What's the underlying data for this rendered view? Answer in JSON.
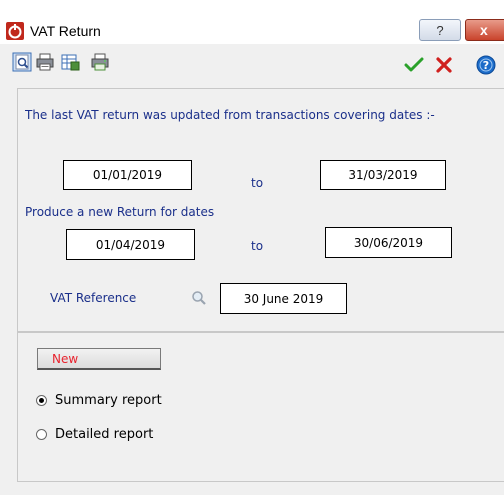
{
  "window": {
    "title": "VAT Return",
    "help_label": "?",
    "close_label": "x"
  },
  "toolbar": {
    "tools": [
      "preview-icon",
      "print-icon",
      "export-icon",
      "print-setup-icon"
    ],
    "actions": [
      "confirm-check-icon",
      "cancel-x-icon",
      "help-info-icon"
    ]
  },
  "last_return": {
    "caption": "The last VAT return was updated from transactions covering dates :-",
    "from_date": "01/01/2019",
    "to_label": "to",
    "to_date": "31/03/2019"
  },
  "new_return": {
    "caption": "Produce a new Return for dates",
    "from_date": "01/04/2019",
    "to_label": "to",
    "to_date": "30/06/2019"
  },
  "vat_reference": {
    "label": "VAT Reference",
    "value": "30 June 2019"
  },
  "report": {
    "new_button_label": "New",
    "options": [
      {
        "label": "Summary report",
        "checked": true
      },
      {
        "label": "Detailed report",
        "checked": false
      }
    ]
  },
  "colors": {
    "label_blue": "#1a2f8a",
    "new_red": "#e8232e",
    "check_green": "#2aa12a",
    "x_red": "#d0201e",
    "info_blue": "#1c6cc9"
  }
}
